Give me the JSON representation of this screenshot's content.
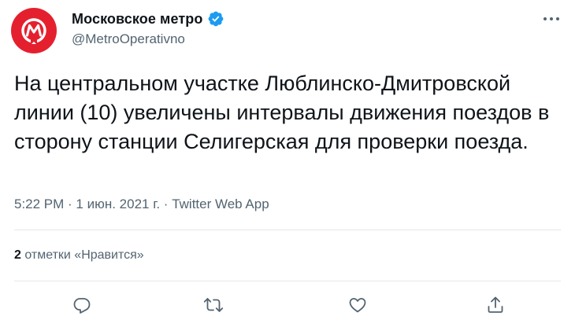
{
  "colors": {
    "brand": "#e5202e",
    "verified": "#1d9bf0",
    "secondary_text": "#536471"
  },
  "author": {
    "display_name": "Московское метро",
    "handle": "@MetroOperativno",
    "avatar_icon": "moscow-metro-logo",
    "verified_icon": "verified-badge-icon"
  },
  "tweet": {
    "text": "На центральном участке Люблинско-Дмитровской линии (10) увеличены интервалы движения поездов в сторону станции Селигерская для проверки поезда."
  },
  "meta": {
    "time": "5:22 PM",
    "separator": " · ",
    "date": "1 июн. 2021 г.",
    "source": "Twitter Web App"
  },
  "likes": {
    "count": "2",
    "label": " отметки «Нравится»"
  },
  "actions": {
    "reply_icon": "reply-icon",
    "retweet_icon": "retweet-icon",
    "like_icon": "heart-icon",
    "share_icon": "share-icon",
    "more_icon": "more-icon"
  }
}
